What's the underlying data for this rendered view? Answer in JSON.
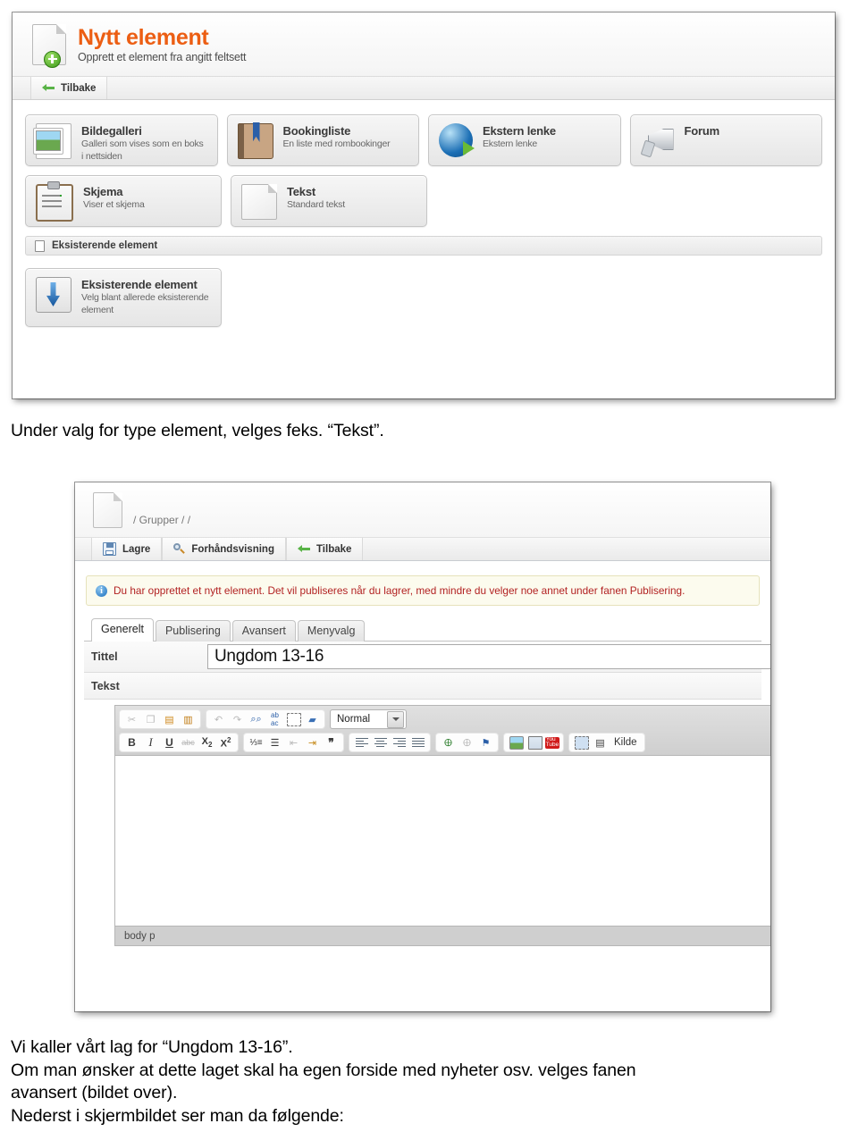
{
  "doc": {
    "paragraph_1": "Under valg for type element, velges feks. “Tekst”.",
    "paragraph_2_lines": [
      "Vi kaller vårt lag for “Ungdom 13-16”.",
      "Om man ønsker at dette laget skal ha egen forside med nyheter osv. velges fanen",
      "avansert (bildet over).",
      "Nederst i skjermbildet ser man da følgende:"
    ]
  },
  "screenshot1": {
    "title": "Nytt element",
    "subtitle": "Opprett et element fra angitt feltsett",
    "toolbar": {
      "back_label": "Tilbake"
    },
    "cards": [
      {
        "name": "Bildegalleri",
        "desc": "Galleri som vises som en boks i nettsiden",
        "icon": "image-gallery-icon"
      },
      {
        "name": "Bookingliste",
        "desc": "En liste med rombookinger",
        "icon": "book-icon"
      },
      {
        "name": "Ekstern lenke",
        "desc": "Ekstern lenke",
        "icon": "globe-link-icon"
      },
      {
        "name": "Forum",
        "desc": "",
        "icon": "megaphone-icon"
      },
      {
        "name": "Skjema",
        "desc": "Viser et skjema",
        "icon": "clipboard-icon"
      },
      {
        "name": "Tekst",
        "desc": "Standard tekst",
        "icon": "page-icon"
      }
    ],
    "section": {
      "label": "Eksisterende element"
    },
    "existing_card": {
      "name": "Eksisterende element",
      "desc": "Velg blant allerede eksisterende element",
      "icon": "download-into-folder-icon"
    }
  },
  "screenshot2": {
    "breadcrumb": "/ Grupper / /",
    "toolbar": {
      "save_label": "Lagre",
      "preview_label": "Forhåndsvisning",
      "back_label": "Tilbake"
    },
    "notice": {
      "text": "Du har opprettet et nytt element. Det vil publiseres når du lagrer, med mindre du velger noe annet under fanen Publisering.",
      "color": "#b22222",
      "background": "#fcfbee"
    },
    "tabs": [
      {
        "label": "Generelt",
        "active": true
      },
      {
        "label": "Publisering",
        "active": false
      },
      {
        "label": "Avansert",
        "active": false
      },
      {
        "label": "Menyvalg",
        "active": false
      }
    ],
    "fields": {
      "title_label": "Tittel",
      "title_value": "Ungdom 13-16",
      "text_label": "Tekst"
    },
    "editor": {
      "format_select": "Normal",
      "source_label": "Kilde",
      "status": "body  p",
      "row1_icons": [
        "cut-icon",
        "copy-icon",
        "paste-icon",
        "paste-word-icon",
        "undo-icon",
        "redo-icon",
        "find-icon",
        "replace-icon",
        "select-all-icon",
        "remove-format-icon"
      ],
      "row2_icons": [
        "bold-icon",
        "italic-icon",
        "underline-icon",
        "strikethrough-icon",
        "subscript-icon",
        "superscript-icon",
        "numbered-list-icon",
        "bulleted-list-icon",
        "outdent-icon",
        "indent-icon",
        "blockquote-icon",
        "align-left-icon",
        "align-center-icon",
        "align-right-icon",
        "align-justify-icon",
        "link-icon",
        "unlink-icon",
        "anchor-icon",
        "image-icon",
        "table-icon",
        "youtube-icon",
        "flash-icon",
        "template-icon",
        "source-icon"
      ]
    }
  }
}
